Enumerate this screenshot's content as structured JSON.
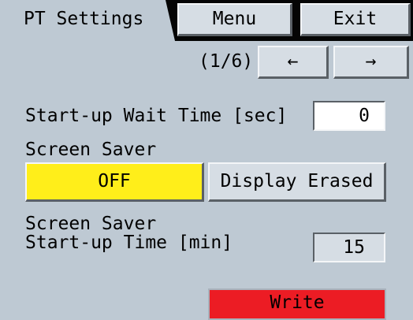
{
  "header": {
    "title": "PT Settings",
    "menu_label": "Menu",
    "exit_label": "Exit"
  },
  "pagination": {
    "indicator": "(1/6)",
    "prev_label": "←",
    "next_label": "→"
  },
  "settings": {
    "wait_time_label": "Start-up Wait Time [sec]",
    "wait_time_value": "0",
    "screen_saver_label": "Screen Saver",
    "screen_saver_options": [
      "OFF",
      "Display Erased"
    ],
    "screen_saver_selected": "OFF",
    "saver_time_label": "Screen Saver\nStart-up Time [min]",
    "saver_time_value": "15"
  },
  "actions": {
    "write_label": "Write"
  },
  "colors": {
    "background": "#bec9d3",
    "selected": "#ffee1a",
    "write": "#ec1c24"
  }
}
